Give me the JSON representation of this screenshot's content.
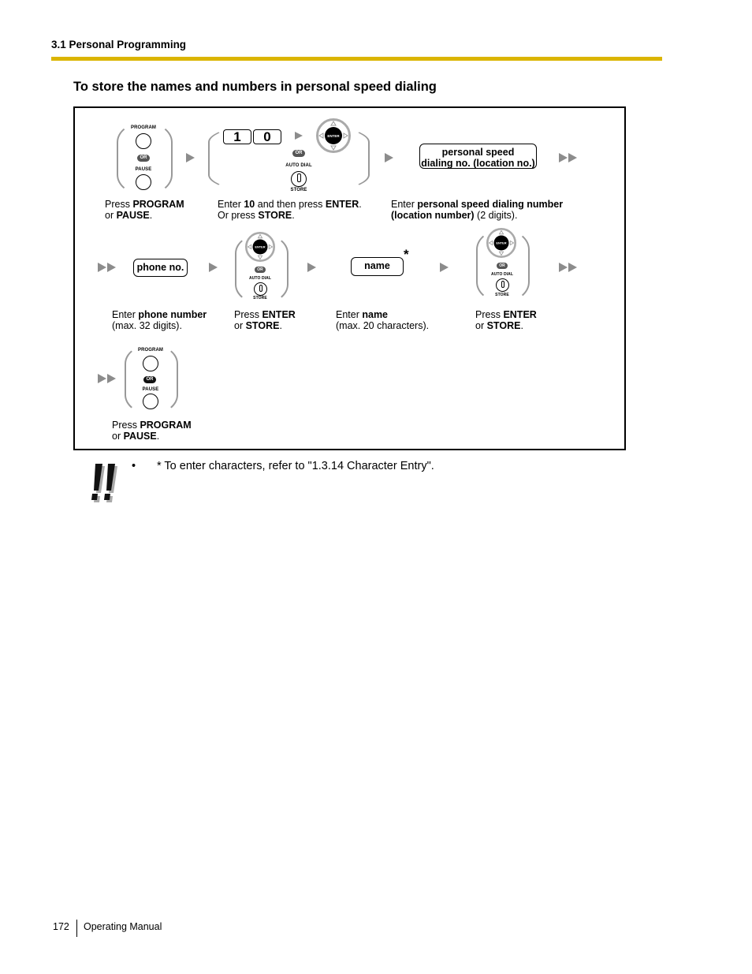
{
  "header": {
    "section": "3.1 Personal Programming",
    "rule_color": "#dbb500"
  },
  "title": "To store the names and numbers in personal speed dialing",
  "steps": [
    {
      "id": "step1",
      "buttons": {
        "top_label": "PROGRAM",
        "or_label": "OR",
        "bottom_label": "PAUSE"
      },
      "caption": {
        "line1_pre": "Press ",
        "line1_bold": "PROGRAM",
        "line2_pre": "or ",
        "line2_bold": "PAUSE",
        "line2_post": "."
      }
    },
    {
      "id": "step2",
      "keys": [
        "1",
        "0"
      ],
      "enter_label": "ENTER",
      "or_label": "OR",
      "auto_dial_label": "AUTO DIAL",
      "store_label": "STORE",
      "caption": {
        "line1_pre": "Enter ",
        "line1_bold": "10",
        "line1_mid": " and then press ",
        "line1_bold2": "ENTER",
        "line1_post": ".",
        "line2_pre": "Or press ",
        "line2_bold": "STORE",
        "line2_post": "."
      }
    },
    {
      "id": "step3",
      "box_line1": "personal speed",
      "box_line2": "dialing no. (location no.)",
      "caption": {
        "line1_pre": "Enter ",
        "line1_bold": "personal speed dialing number",
        "line2_bold": "(location number)",
        "line2_post": " (2 digits)."
      }
    },
    {
      "id": "step4",
      "box": "phone no.",
      "caption": {
        "line1_pre": "Enter ",
        "line1_bold": "phone number",
        "line2": "(max. 32 digits)."
      }
    },
    {
      "id": "step5",
      "enter_label": "ENTER",
      "or_label": "OR",
      "auto_dial_label": "AUTO DIAL",
      "store_label": "STORE",
      "caption": {
        "line1_pre": "Press ",
        "line1_bold": "ENTER",
        "line2_pre": "or ",
        "line2_bold": "STORE",
        "line2_post": "."
      }
    },
    {
      "id": "step6",
      "box": "name",
      "footnote_mark": "*",
      "caption": {
        "line1_pre": "Enter ",
        "line1_bold": "name",
        "line2": "(max. 20 characters)."
      }
    },
    {
      "id": "step7",
      "enter_label": "ENTER",
      "or_label": "OR",
      "auto_dial_label": "AUTO DIAL",
      "store_label": "STORE",
      "caption": {
        "line1_pre": "Press ",
        "line1_bold": "ENTER",
        "line2_pre": "or ",
        "line2_bold": "STORE",
        "line2_post": "."
      }
    },
    {
      "id": "step8",
      "buttons": {
        "top_label": "PROGRAM",
        "or_label": "OR",
        "bottom_label": "PAUSE"
      },
      "caption": {
        "line1_pre": "Press ",
        "line1_bold": "PROGRAM",
        "line2_pre": "or ",
        "line2_bold": "PAUSE",
        "line2_post": "."
      }
    }
  ],
  "note": {
    "icon": "double-exclamation-icon",
    "bullet": "•",
    "text": "* To enter characters, refer to \"1.3.14 Character Entry\"."
  },
  "footer": {
    "page_number": "172",
    "manual": "Operating Manual"
  }
}
